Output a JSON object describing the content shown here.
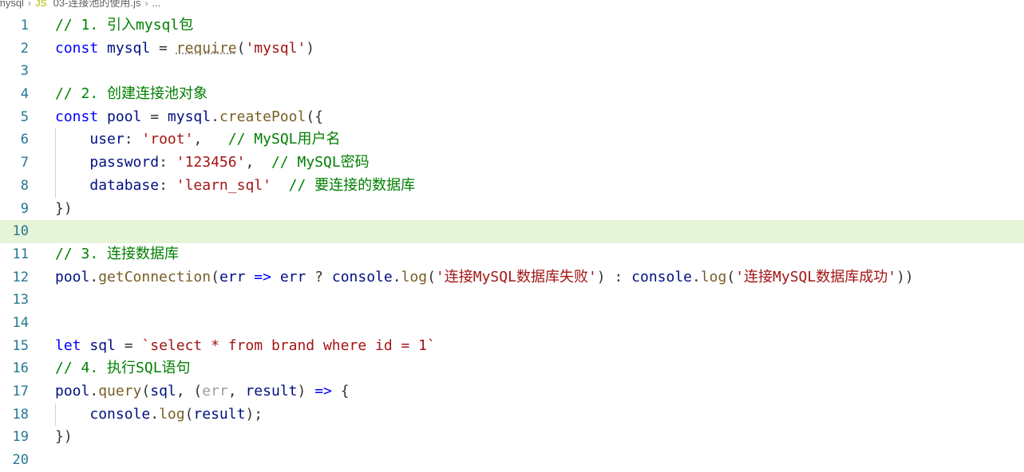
{
  "breadcrumb": {
    "folder": "mysql",
    "file_icon": "JS",
    "file": "03-连接池的使用.js",
    "more": "..."
  },
  "colors": {
    "comment": "#008000",
    "keyword": "#0000ff",
    "variable": "#001080",
    "function": "#795e26",
    "string": "#a31515",
    "line_number": "#237893",
    "current_line_bg": "#e6f4d7"
  },
  "lines": [
    {
      "n": "1",
      "tokens": [
        [
          "c",
          "// 1. 引入mysql包"
        ]
      ]
    },
    {
      "n": "2",
      "tokens": [
        [
          "k",
          "const"
        ],
        [
          "p",
          " "
        ],
        [
          "v",
          "mysql"
        ],
        [
          "p",
          " = "
        ],
        [
          "f squiggle",
          "require"
        ],
        [
          "p",
          "("
        ],
        [
          "s",
          "'mysql'"
        ],
        [
          "p",
          ")"
        ]
      ]
    },
    {
      "n": "3",
      "tokens": []
    },
    {
      "n": "4",
      "tokens": [
        [
          "c",
          "// 2. 创建连接池对象"
        ]
      ]
    },
    {
      "n": "5",
      "tokens": [
        [
          "k",
          "const"
        ],
        [
          "p",
          " "
        ],
        [
          "v",
          "pool"
        ],
        [
          "p",
          " = "
        ],
        [
          "v",
          "mysql"
        ],
        [
          "p",
          "."
        ],
        [
          "f",
          "createPool"
        ],
        [
          "p",
          "({"
        ]
      ]
    },
    {
      "n": "6",
      "guide": true,
      "tokens": [
        [
          "p",
          "    "
        ],
        [
          "v",
          "user"
        ],
        [
          "p",
          ": "
        ],
        [
          "s",
          "'root'"
        ],
        [
          "p",
          ",   "
        ],
        [
          "c",
          "// MySQL用户名"
        ]
      ]
    },
    {
      "n": "7",
      "guide": true,
      "tokens": [
        [
          "p",
          "    "
        ],
        [
          "v",
          "password"
        ],
        [
          "p",
          ": "
        ],
        [
          "s",
          "'123456'"
        ],
        [
          "p",
          ",  "
        ],
        [
          "c",
          "// MySQL密码"
        ]
      ]
    },
    {
      "n": "8",
      "guide": true,
      "tokens": [
        [
          "p",
          "    "
        ],
        [
          "v",
          "database"
        ],
        [
          "p",
          ": "
        ],
        [
          "s",
          "'learn_sql'"
        ],
        [
          "p",
          "  "
        ],
        [
          "c",
          "// 要连接的数据库"
        ]
      ]
    },
    {
      "n": "9",
      "tokens": [
        [
          "p",
          "})"
        ]
      ]
    },
    {
      "n": "10",
      "current": true,
      "tokens": []
    },
    {
      "n": "11",
      "tokens": [
        [
          "c",
          "// 3. 连接数据库"
        ]
      ]
    },
    {
      "n": "12",
      "tokens": [
        [
          "v",
          "pool"
        ],
        [
          "p",
          "."
        ],
        [
          "f",
          "getConnection"
        ],
        [
          "p",
          "("
        ],
        [
          "v",
          "err"
        ],
        [
          "p",
          " "
        ],
        [
          "k",
          "=>"
        ],
        [
          "p",
          " "
        ],
        [
          "v",
          "err"
        ],
        [
          "p",
          " ? "
        ],
        [
          "v",
          "console"
        ],
        [
          "p",
          "."
        ],
        [
          "f",
          "log"
        ],
        [
          "p",
          "("
        ],
        [
          "s",
          "'连接MySQL数据库失败'"
        ],
        [
          "p",
          ") : "
        ],
        [
          "v",
          "console"
        ],
        [
          "p",
          "."
        ],
        [
          "f",
          "log"
        ],
        [
          "p",
          "("
        ],
        [
          "s",
          "'连接MySQL数据库成功'"
        ],
        [
          "p",
          "))"
        ]
      ]
    },
    {
      "n": "13",
      "tokens": []
    },
    {
      "n": "14",
      "tokens": []
    },
    {
      "n": "15",
      "tokens": [
        [
          "k",
          "let"
        ],
        [
          "p",
          " "
        ],
        [
          "v",
          "sql"
        ],
        [
          "p",
          " = "
        ],
        [
          "s",
          "`select * from brand where id = 1`"
        ]
      ]
    },
    {
      "n": "16",
      "tokens": [
        [
          "c",
          "// 4. 执行SQL语句"
        ]
      ]
    },
    {
      "n": "17",
      "tokens": [
        [
          "v",
          "pool"
        ],
        [
          "p",
          "."
        ],
        [
          "f",
          "query"
        ],
        [
          "p",
          "("
        ],
        [
          "v",
          "sql"
        ],
        [
          "p",
          ", ("
        ],
        [
          "dim",
          "err"
        ],
        [
          "p",
          ", "
        ],
        [
          "v",
          "result"
        ],
        [
          "p",
          ") "
        ],
        [
          "k",
          "=>"
        ],
        [
          "p",
          " {"
        ]
      ]
    },
    {
      "n": "18",
      "guide": true,
      "tokens": [
        [
          "p",
          "    "
        ],
        [
          "v",
          "console"
        ],
        [
          "p",
          "."
        ],
        [
          "f",
          "log"
        ],
        [
          "p",
          "("
        ],
        [
          "v",
          "result"
        ],
        [
          "p",
          ");"
        ]
      ]
    },
    {
      "n": "19",
      "tokens": [
        [
          "p",
          "})"
        ]
      ]
    },
    {
      "n": "20",
      "tokens": []
    }
  ]
}
